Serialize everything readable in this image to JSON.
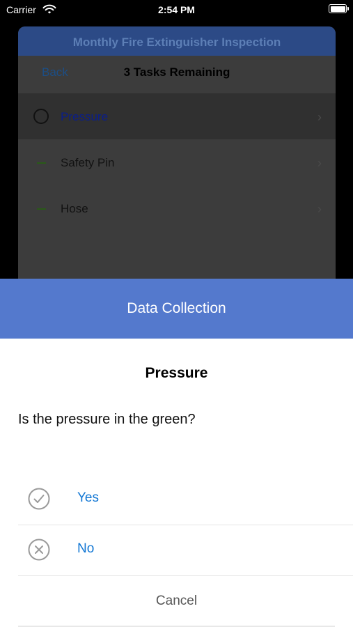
{
  "status_bar": {
    "carrier": "Carrier",
    "time": "2:54 PM"
  },
  "background": {
    "title": "Monthly Fire Extinguisher Inspection",
    "nav": {
      "back": "Back",
      "title": "3 Tasks Remaining"
    },
    "tasks": [
      {
        "label": "Pressure"
      },
      {
        "label": "Safety Pin"
      },
      {
        "label": "Hose"
      }
    ]
  },
  "modal": {
    "header": "Data Collection",
    "task_title": "Pressure",
    "question": "Is the pressure in the green?",
    "options": [
      {
        "label": "Yes",
        "icon": "checkmark-circle-icon"
      },
      {
        "label": "No",
        "icon": "x-circle-icon"
      }
    ],
    "cancel": "Cancel"
  },
  "colors": {
    "header_blue": "#5479cd",
    "option_blue": "#1277d4"
  }
}
